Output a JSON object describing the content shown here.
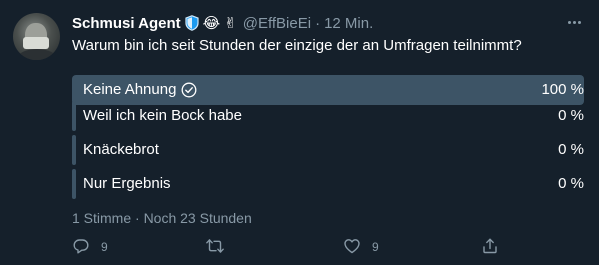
{
  "tweet": {
    "author_name": "Schmusi Agent",
    "author_handle": "@EffBieEi",
    "separator": "·",
    "time": "12 Min.",
    "emojis": [
      "😂",
      "✌"
    ],
    "text": "Warum bin ich seit Stunden der einzige der an Umfragen teilnimmt?"
  },
  "poll": {
    "options": [
      {
        "label": "Keine Ahnung",
        "percent_label": "100 %",
        "percent": 100,
        "selected": true
      },
      {
        "label": "Weil ich kein Bock habe",
        "percent_label": "0 %",
        "percent": 0,
        "selected": false
      },
      {
        "label": "Knäckebrot",
        "percent_label": "0 %",
        "percent": 0,
        "selected": false
      },
      {
        "label": "Nur Ergebnis",
        "percent_label": "0 %",
        "percent": 0,
        "selected": false
      }
    ],
    "meta": "1 Stimme · Noch 23 Stunden"
  },
  "actions": {
    "reply_count": "9",
    "like_count": "9"
  },
  "colors": {
    "background": "#15202b",
    "bar": "#3d5466",
    "muted": "#8899a6",
    "badge_blue": "#1d9bf0"
  },
  "icons": {
    "badge": "shield-badge-icon",
    "more": "more-dots-icon",
    "check": "check-circle-icon",
    "reply": "reply-icon",
    "retweet": "retweet-icon",
    "like": "heart-icon",
    "share": "share-icon"
  }
}
